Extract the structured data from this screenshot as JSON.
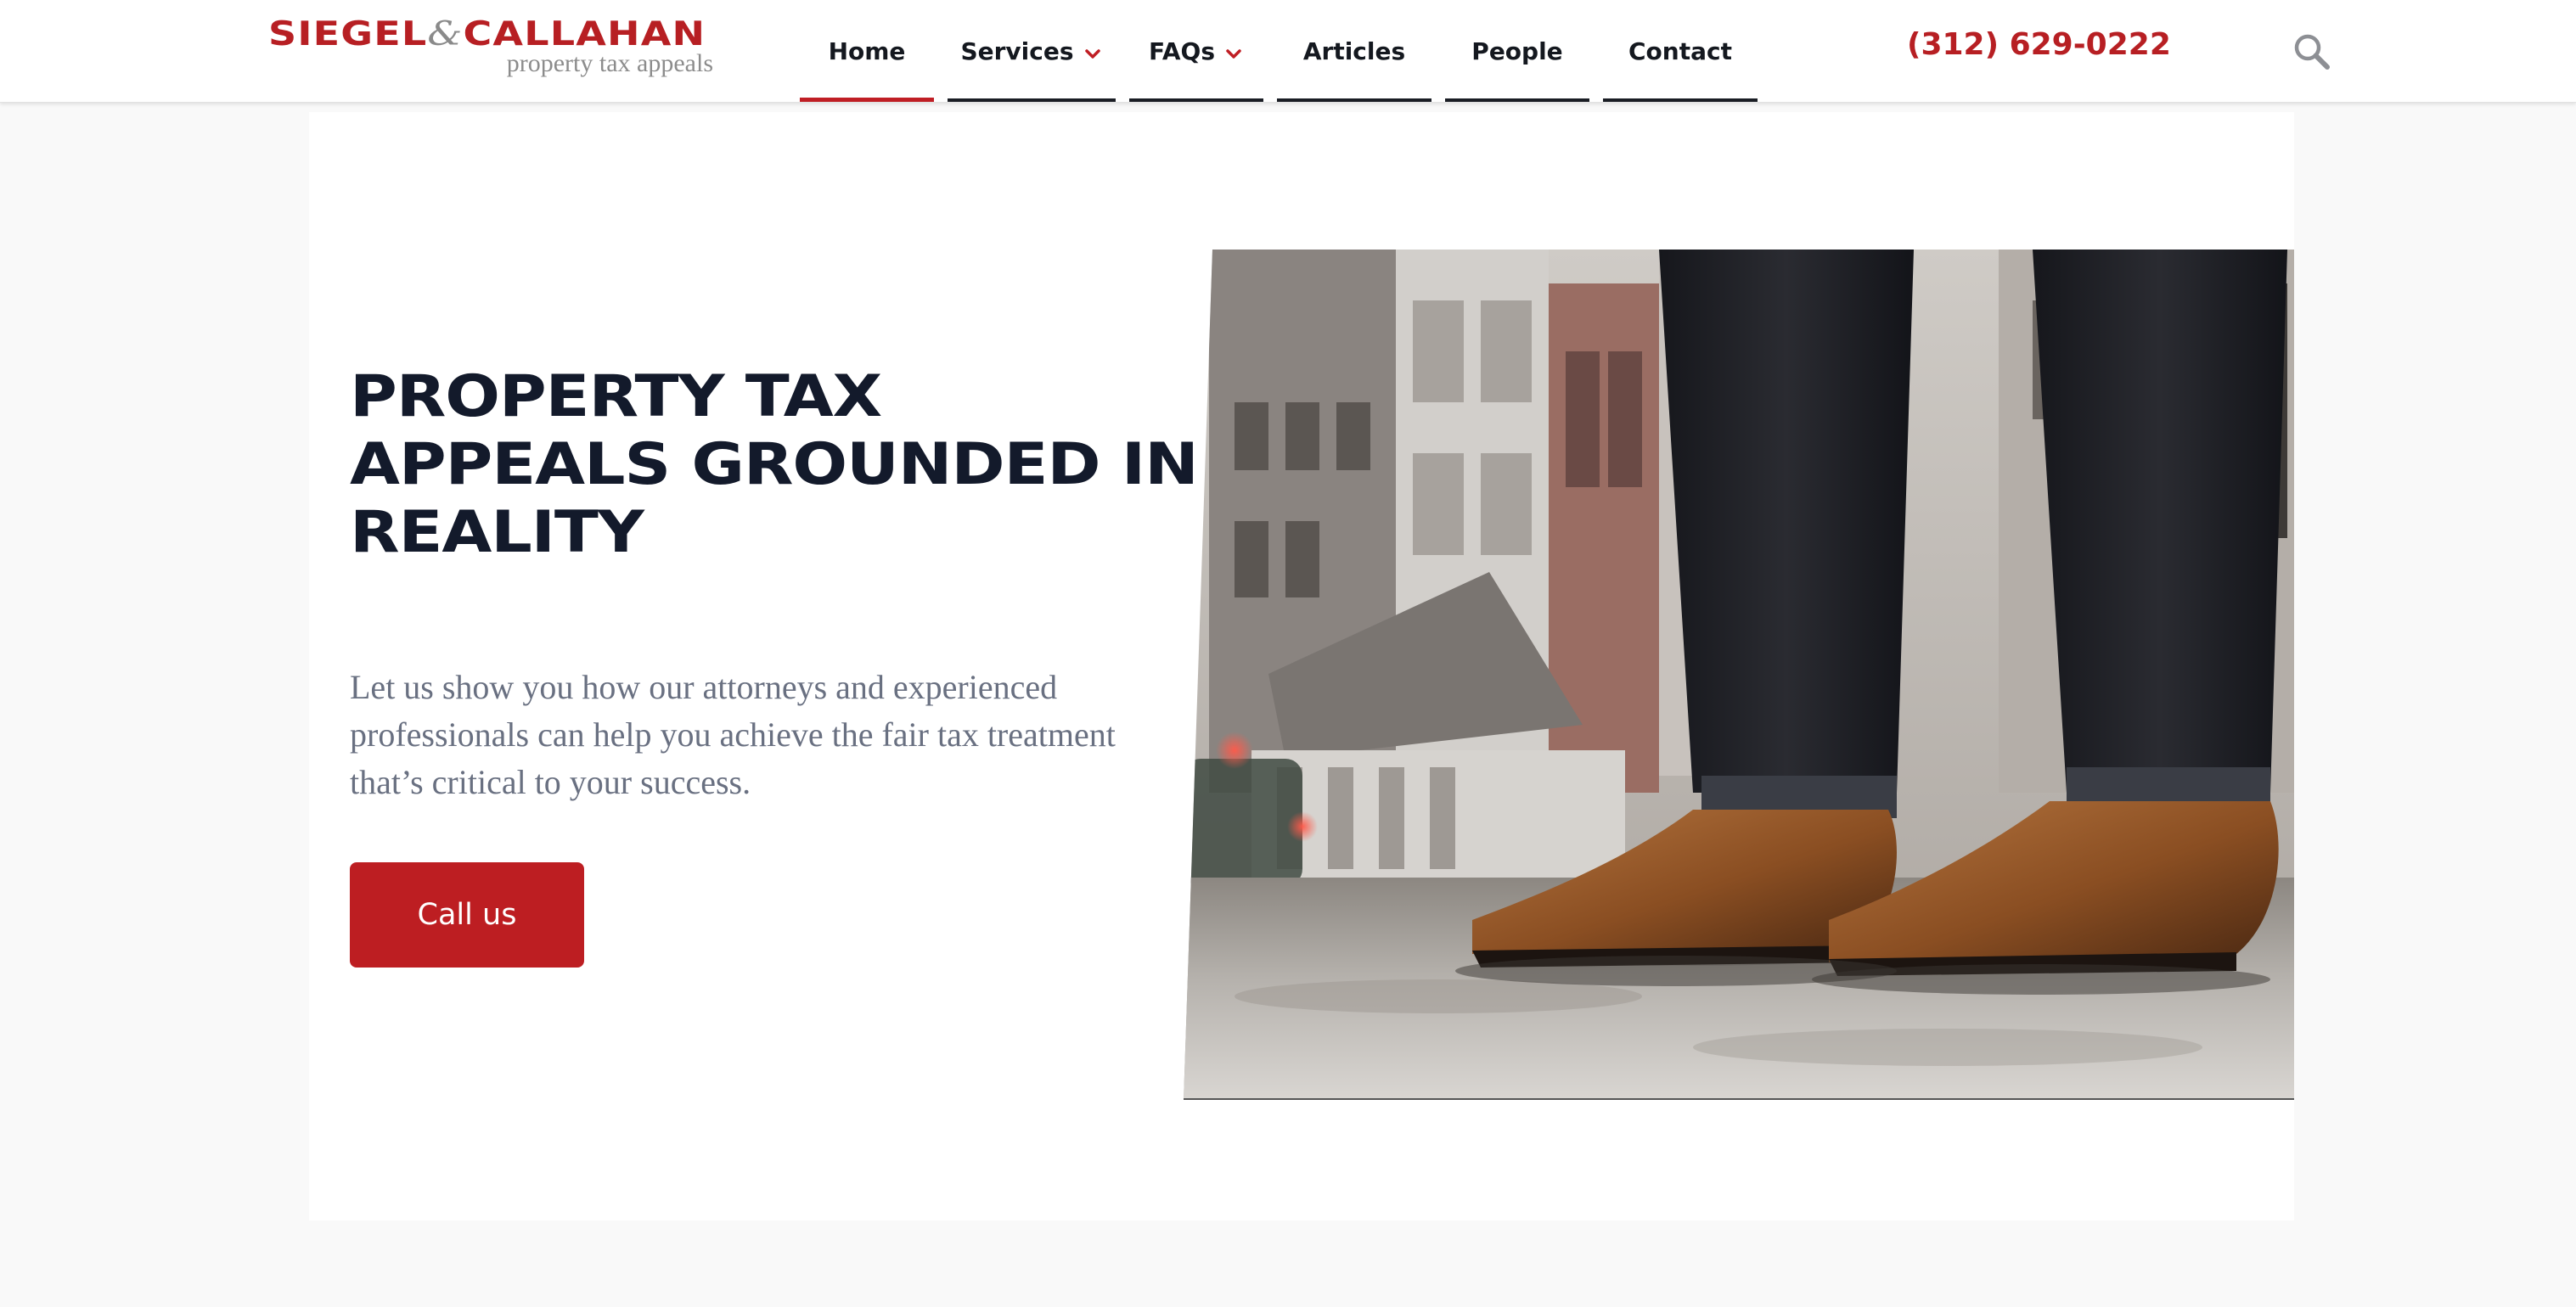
{
  "header": {
    "logo": {
      "name_left": "SIEGEL",
      "ampersand": "&",
      "name_right": "CALLAHAN",
      "tagline": "property tax appeals"
    },
    "nav": [
      {
        "label": "Home",
        "active": true,
        "has_dropdown": false
      },
      {
        "label": "Services",
        "active": false,
        "has_dropdown": true
      },
      {
        "label": "FAQs",
        "active": false,
        "has_dropdown": true
      },
      {
        "label": "Articles",
        "active": false,
        "has_dropdown": false
      },
      {
        "label": "People",
        "active": false,
        "has_dropdown": false
      },
      {
        "label": "Contact",
        "active": false,
        "has_dropdown": false
      }
    ],
    "phone": "(312) 629-0222",
    "search_icon": "search-icon"
  },
  "hero": {
    "title": "Property Tax Appeals Grounded in Reality",
    "text": "Let us show you how our attorneys and experienced professionals can help you achieve the fair tax treatment that’s critical to your success.",
    "cta_label": "Call us"
  },
  "colors": {
    "brand_red": "#b71f23",
    "button_red": "#bd1e22",
    "heading": "#131a2b",
    "body_text": "#697081",
    "nav_text": "#14181f"
  },
  "icons": {
    "dropdown": "chevron-down-icon",
    "search": "search-icon"
  }
}
